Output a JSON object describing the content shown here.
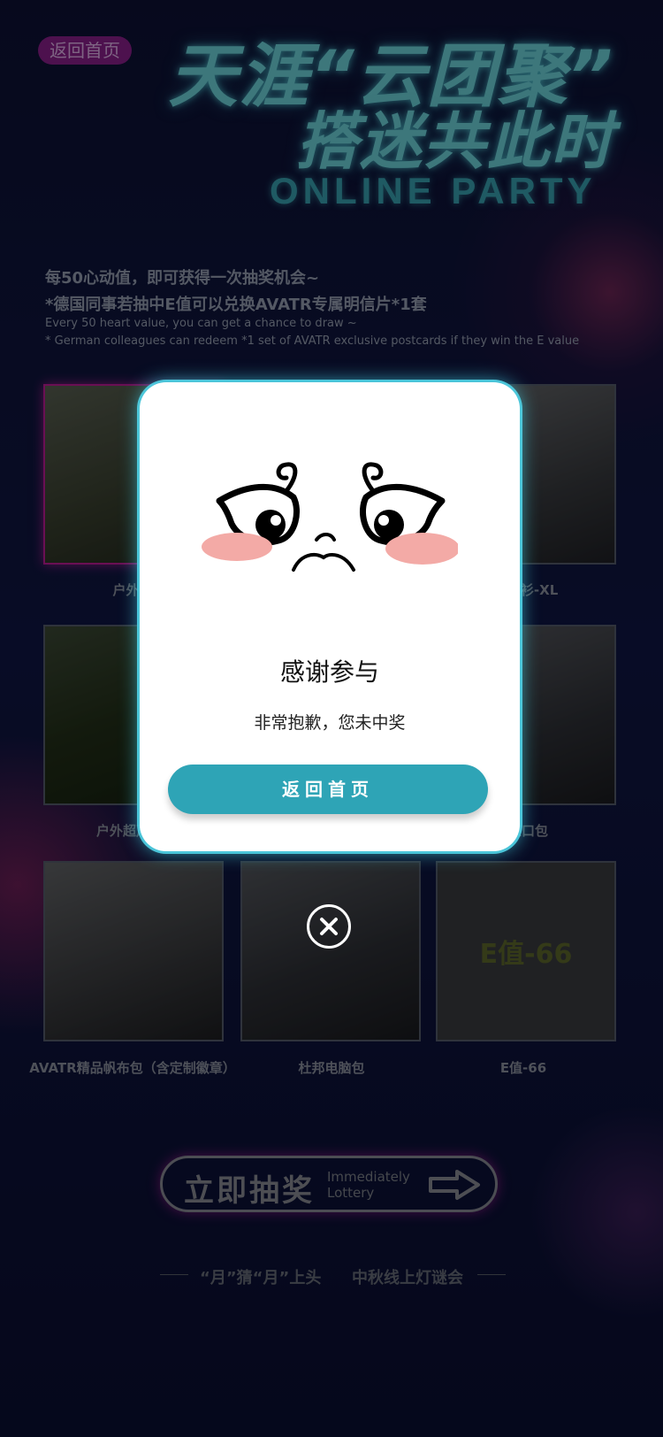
{
  "header": {
    "back_label": "返回首页",
    "title_line1": "天涯“云团聚”",
    "title_line2": "搭迷共此时",
    "title_en": "ONLINE PARTY"
  },
  "intro": {
    "cn_line1": "每50心动值，即可获得一次抽奖机会~",
    "cn_line2": "*德国同事若抽中E值可以兑换AVATR专属明信片*1套",
    "en_line1": "Every 50 heart value, you can get a chance to draw ~",
    "en_line2": "* German colleagues can redeem *1 set of AVATR exclusive postcards if they win the E value"
  },
  "prizes": [
    {
      "caption": "户外桌"
    },
    {
      "caption": "列T恤衫-XL"
    },
    {
      "caption": "户外超声波防"
    },
    {
      "caption": "保束口包"
    },
    {
      "caption": "AVATR精品帆布包（含定制徽章）"
    },
    {
      "caption": "杜邦电脑包"
    },
    {
      "caption": "E值-66",
      "label": "E值-66"
    }
  ],
  "draw_button": {
    "cn": "立即抽奖",
    "en_line1": "Immediately",
    "en_line2": "Lottery"
  },
  "footer": {
    "left": "“月”猜“月”上头",
    "right": "中秋线上灯谜会"
  },
  "modal": {
    "title": "感谢参与",
    "message": "非常抱歉，您未中奖",
    "button": "返回首页",
    "icon": "sad-face-icon",
    "button_color": "#2ea4b6"
  },
  "close_icon": "close-circle-icon"
}
